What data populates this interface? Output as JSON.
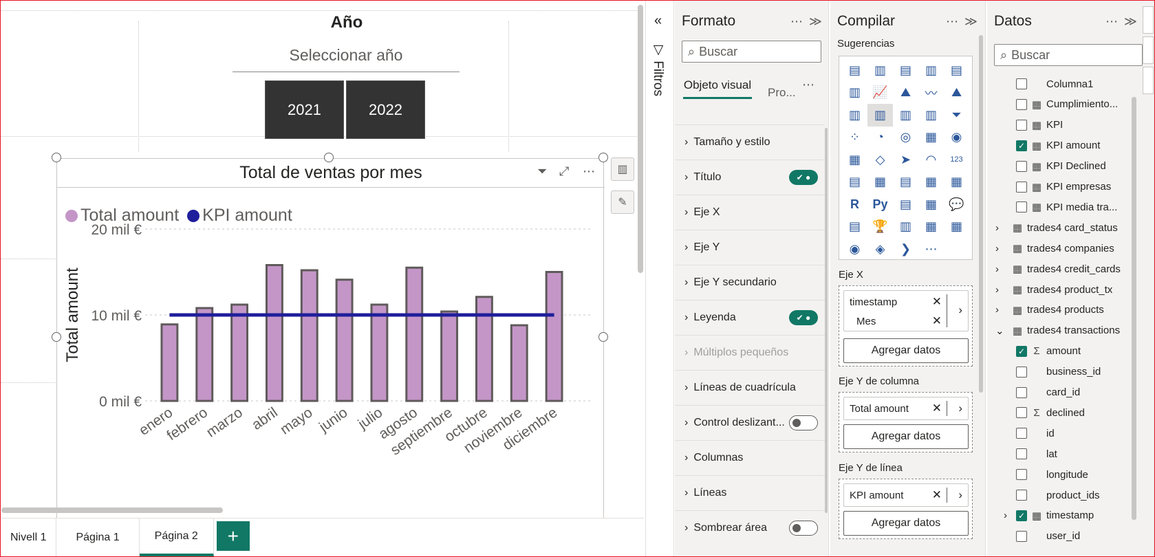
{
  "canvas": {
    "slicer": {
      "title": "Año",
      "placeholder": "Seleccionar año",
      "options": [
        "2021",
        "2022"
      ]
    },
    "visual": {
      "title": "Total de ventas por mes",
      "legend": [
        {
          "name": "Total amount",
          "color": "#c496c8"
        },
        {
          "name": "KPI amount",
          "color": "#1f1e9b"
        }
      ]
    }
  },
  "chart_data": {
    "type": "bar",
    "title": "Total de ventas por mes",
    "categories": [
      "enero",
      "febrero",
      "marzo",
      "abril",
      "mayo",
      "junio",
      "julio",
      "agosto",
      "septiembre",
      "octubre",
      "noviembre",
      "diciembre"
    ],
    "series": [
      {
        "name": "Total amount",
        "type": "bar",
        "color": "#c496c8",
        "values": [
          8900,
          10800,
          11200,
          15800,
          15200,
          14100,
          11200,
          15500,
          10400,
          12100,
          8800,
          15000
        ]
      },
      {
        "name": "KPI amount",
        "type": "line",
        "color": "#1f1e9b",
        "values": [
          10000,
          10000,
          10000,
          10000,
          10000,
          10000,
          10000,
          10000,
          10000,
          10000,
          10000,
          10000
        ]
      }
    ],
    "ylabel": "Total amount",
    "xlabel": "",
    "ylim": [
      0,
      20000
    ],
    "yticks": [
      "0 mil €",
      "10 mil €",
      "20 mil €"
    ],
    "ytick_values": [
      0,
      10000,
      20000
    ],
    "grid": true,
    "legend_position": "top-left"
  },
  "tabs": {
    "items": [
      "Nivell 1",
      "Página 1",
      "Página 2"
    ],
    "active": "Página 2",
    "add": "+"
  },
  "filters": {
    "label": "Filtros",
    "collapse": "«"
  },
  "format_pane": {
    "title": "Formato",
    "search_placeholder": "Buscar",
    "tab_visual": "Objeto visual",
    "tab_general": "Pro...",
    "sections": [
      {
        "label": "Tamaño y estilo",
        "toggle": "none"
      },
      {
        "label": "Título",
        "toggle": "on"
      },
      {
        "label": "Eje X",
        "toggle": "none"
      },
      {
        "label": "Eje Y",
        "toggle": "none"
      },
      {
        "label": "Eje Y secundario",
        "toggle": "none"
      },
      {
        "label": "Leyenda",
        "toggle": "on"
      },
      {
        "label": "Múltiplos pequeños",
        "toggle": "disabled"
      },
      {
        "label": "Líneas de cuadrícula",
        "toggle": "none"
      },
      {
        "label": "Control deslizant...",
        "toggle": "off"
      },
      {
        "label": "Columnas",
        "toggle": "none"
      },
      {
        "label": "Líneas",
        "toggle": "none"
      },
      {
        "label": "Sombrear área",
        "toggle": "off"
      }
    ]
  },
  "build_pane": {
    "title": "Compilar",
    "suggestions_label": "Sugerencias",
    "x_axis_label": "Eje X",
    "x_axis_fields": [
      "timestamp",
      "Mes"
    ],
    "y_column_label": "Eje Y de columna",
    "y_column_field": "Total amount",
    "y_line_label": "Eje Y de línea",
    "y_line_field": "KPI amount",
    "add_data": "Agregar datos",
    "visual_icons": [
      "▤",
      "▥",
      "▤",
      "▥",
      "▤",
      "▥",
      "📈",
      "⛰",
      "〰",
      "⛰",
      "▥",
      "▥",
      "▥",
      "▥",
      "⏷",
      "⁘",
      "◔",
      "◎",
      "▦",
      "◉",
      "▦",
      "◇",
      "➤",
      "◠",
      "123",
      "▤",
      "▦",
      "▤",
      "▦",
      "▦",
      "R",
      "Py",
      "▤",
      "▦",
      "💬",
      "▤",
      "🏆",
      "▥",
      "▦",
      "▦",
      "◉",
      "◈",
      "❯",
      "⋯"
    ]
  },
  "data_pane": {
    "title": "Datos",
    "search_placeholder": "Buscar",
    "items": [
      {
        "label": "Columna1",
        "kind": "col",
        "checked": false,
        "indent": 1
      },
      {
        "label": "Cumplimiento...",
        "kind": "measure",
        "checked": false,
        "indent": 1
      },
      {
        "label": "KPI",
        "kind": "measure",
        "checked": false,
        "indent": 1
      },
      {
        "label": "KPI amount",
        "kind": "measure",
        "checked": true,
        "indent": 1
      },
      {
        "label": "KPI Declined",
        "kind": "measure",
        "checked": false,
        "indent": 1
      },
      {
        "label": "KPI empresas",
        "kind": "measure",
        "checked": false,
        "indent": 1
      },
      {
        "label": "KPI media tra...",
        "kind": "measure",
        "checked": false,
        "indent": 1
      },
      {
        "label": "trades4 card_status",
        "kind": "table",
        "indent": 0
      },
      {
        "label": "trades4 companies",
        "kind": "table",
        "indent": 0
      },
      {
        "label": "trades4 credit_cards",
        "kind": "table",
        "indent": 0
      },
      {
        "label": "trades4 product_tx",
        "kind": "table",
        "indent": 0
      },
      {
        "label": "trades4 products",
        "kind": "table",
        "indent": 0
      },
      {
        "label": "trades4 transactions",
        "kind": "table-open",
        "indent": 0
      },
      {
        "label": "amount",
        "kind": "sum",
        "checked": true,
        "indent": 1
      },
      {
        "label": "business_id",
        "kind": "col",
        "checked": false,
        "indent": 1
      },
      {
        "label": "card_id",
        "kind": "col",
        "checked": false,
        "indent": 1
      },
      {
        "label": "declined",
        "kind": "sum",
        "checked": false,
        "indent": 1
      },
      {
        "label": "id",
        "kind": "col",
        "checked": false,
        "indent": 1
      },
      {
        "label": "lat",
        "kind": "col",
        "checked": false,
        "indent": 1
      },
      {
        "label": "longitude",
        "kind": "col",
        "checked": false,
        "indent": 1
      },
      {
        "label": "product_ids",
        "kind": "col",
        "checked": false,
        "indent": 1
      },
      {
        "label": "timestamp",
        "kind": "hier",
        "checked": true,
        "indent": 1
      },
      {
        "label": "user_id",
        "kind": "col",
        "checked": false,
        "indent": 1
      }
    ]
  }
}
